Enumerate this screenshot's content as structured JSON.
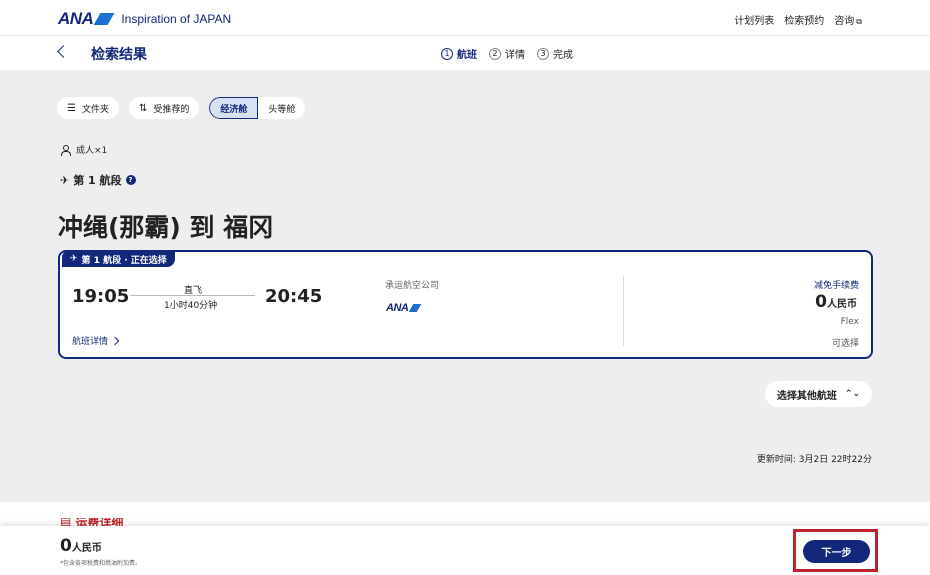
{
  "header": {
    "logo": "ANA",
    "tagline": "Inspiration of JAPAN",
    "nav": [
      "计划列表",
      "检索预约",
      "咨询"
    ]
  },
  "subheader": {
    "title": "检索结果",
    "steps": [
      {
        "num": "1",
        "label": "航班",
        "active": true
      },
      {
        "num": "2",
        "label": "详情",
        "active": false
      },
      {
        "num": "3",
        "label": "完成",
        "active": false
      }
    ]
  },
  "filters": {
    "folder": "文件夹",
    "sort": "受推荐的",
    "cabin_economy": "经济舱",
    "cabin_first": "头等舱"
  },
  "passengers": "成人×1",
  "segment": {
    "label": "第 1 航段",
    "route": "冲绳(那霸) 到 福冈"
  },
  "flight": {
    "tag": "第 1 航段 · 正在选择",
    "departure": "19:05",
    "arrival": "20:45",
    "type": "直飞",
    "duration": "1小时40分钟",
    "detail_link": "航班详情",
    "carrier_label": "承运航空公司",
    "carrier_logo": "ANA",
    "fee_label": "减免手续费",
    "fare_amount": "0",
    "fare_unit": "人民币",
    "fare_class": "Flex",
    "availability": "可选择"
  },
  "other_flights": "选择其他航班",
  "updated": "更新时间:  3月2日 22时22分",
  "notice": "运费详细",
  "footer": {
    "total_amount": "0",
    "total_unit": "人民币",
    "note": "*包含各项税费和燃油附加费。",
    "next_label": "下一步"
  },
  "colors": {
    "brand": "#13287a",
    "highlight": "#c0202a"
  }
}
